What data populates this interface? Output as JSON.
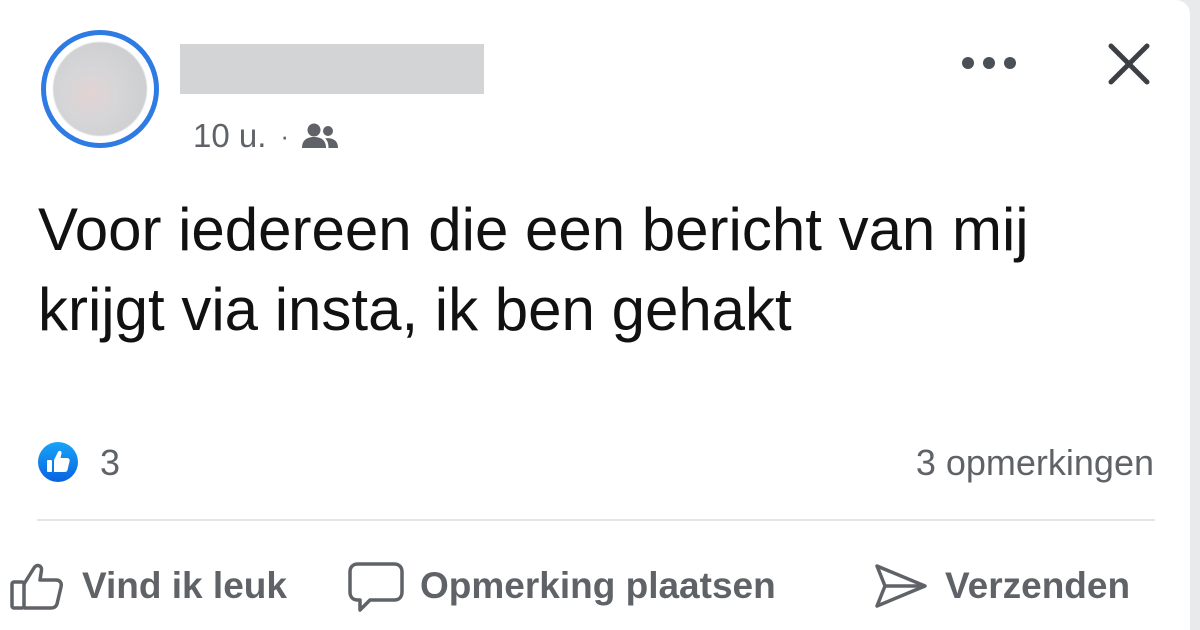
{
  "post": {
    "time": "10 u.",
    "separator": "·",
    "audience_icon": "friends-icon",
    "text": "Voor iedereen die een bericht van mij krijgt via insta, ik ben gehakt",
    "reactions": {
      "icon": "like-reaction-icon",
      "count": "3"
    },
    "comments_label": "3 opmerkingen"
  },
  "actions": {
    "like": "Vind ik leuk",
    "comment": "Opmerking plaatsen",
    "send": "Verzenden"
  },
  "colors": {
    "accent": "#1877f2",
    "avatar_ring": "#2e7be4",
    "text_primary": "#111111",
    "text_secondary": "#5f6368"
  }
}
